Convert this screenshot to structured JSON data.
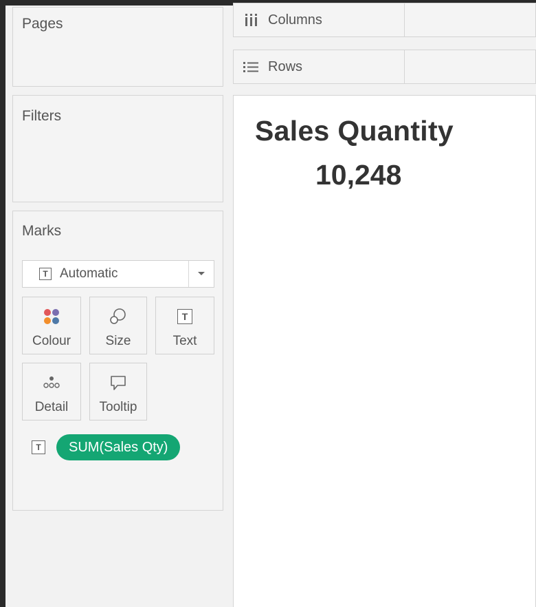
{
  "left_panel": {
    "pages_title": "Pages",
    "filters_title": "Filters",
    "marks_title": "Marks"
  },
  "shelves": {
    "columns_label": "Columns",
    "rows_label": "Rows",
    "columns_icon": "columns-icon",
    "rows_icon": "rows-list-icon"
  },
  "marks": {
    "mark_type": "Automatic",
    "mark_type_icon": "text-mark-icon",
    "tiles": {
      "colour": "Colour",
      "size": "Size",
      "text": "Text",
      "detail": "Detail",
      "tooltip": "Tooltip"
    },
    "pill": {
      "label": "SUM(Sales Qty)",
      "icon": "text-mark-icon",
      "color": "#14a673"
    }
  },
  "canvas": {
    "title": "Sales Quantity",
    "value": "10,248"
  },
  "colors": {
    "pill_green": "#14a673",
    "colour_dots": [
      "#e15759",
      "#7b6fb0",
      "#f28e2b",
      "#4e79a7"
    ]
  }
}
